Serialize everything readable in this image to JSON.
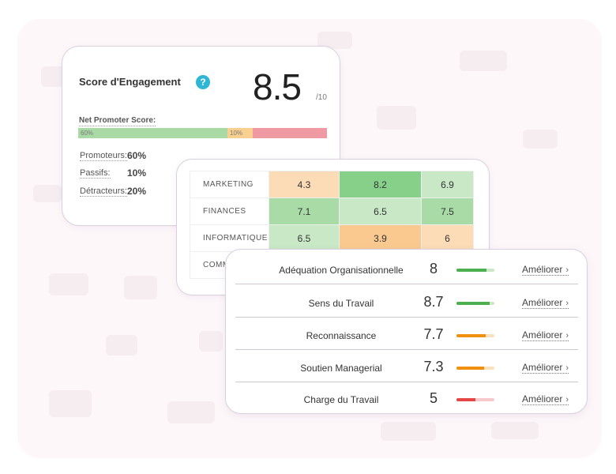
{
  "score_card": {
    "title": "Score d'Engagement",
    "help_icon": "question-mark-icon",
    "score": "8.5",
    "max": "/10",
    "nps_label": "Net Promoter Score:",
    "nps_segments": [
      {
        "label": "60%",
        "fraction": 0.6,
        "color": "#a9d9a4"
      },
      {
        "label": "10%",
        "fraction": 0.1,
        "color": "#f9d08f"
      },
      {
        "label": "",
        "fraction": 0.3,
        "color": "#ef9aa2"
      }
    ],
    "promoteurs_label": "Promoteurs:",
    "promoteurs_value": "60%",
    "passifs_label": "Passifs:",
    "passifs_value": "10%",
    "detracteurs_label": "Détracteurs:",
    "detracteurs_value": "20%"
  },
  "heatmap": {
    "rows": [
      {
        "dept": "MARKETING",
        "values": [
          "4.3",
          "8.2",
          "6.9"
        ],
        "colors": [
          "#fbdcb6",
          "#86d08a",
          "#c8e8c6"
        ]
      },
      {
        "dept": "FINANCES",
        "values": [
          "7.1",
          "6.5",
          "7.5"
        ],
        "colors": [
          "#a8dba6",
          "#c8e8c6",
          "#a8dba6"
        ]
      },
      {
        "dept": "INFORMATIQUE",
        "values": [
          "6.5",
          "3.9",
          "6"
        ],
        "colors": [
          "#c8e8c6",
          "#f9c98f",
          "#fbdcb6"
        ]
      },
      {
        "dept": "COMM",
        "values": [
          "",
          "",
          ""
        ],
        "colors": [
          "#c8e8c6",
          "#fbdcb6",
          "#c8e8c6"
        ]
      }
    ]
  },
  "dimensions": {
    "link_label": "Améliorer",
    "items": [
      {
        "label": "Adéquation Organisationnelle",
        "score": "8",
        "level": 0.8,
        "icon": "people-icon",
        "icon_color": "#a9d9a4",
        "bar_color": "#4caf50",
        "track_color": "#cbe9c9"
      },
      {
        "label": "Sens du Travail",
        "score": "8.7",
        "level": 0.87,
        "icon": "person-icon",
        "icon_color": "#a9d9a4",
        "bar_color": "#4caf50",
        "track_color": "#cbe9c9"
      },
      {
        "label": "Reconnaissance",
        "score": "7.7",
        "level": 0.77,
        "icon": "person-icon",
        "icon_color": "#f9c98f",
        "bar_color": "#f0900e",
        "track_color": "#fbe0bd"
      },
      {
        "label": "Soutien Managerial",
        "score": "7.3",
        "level": 0.73,
        "icon": "person-icon",
        "icon_color": "#f9c98f",
        "bar_color": "#f0900e",
        "track_color": "#fbe0bd"
      },
      {
        "label": "Charge du Travail",
        "score": "5",
        "level": 0.5,
        "icon": "coffee-cup-icon",
        "icon_color": "#ef8a94",
        "bar_color": "#e64545",
        "track_color": "#f8c8cd"
      }
    ]
  }
}
